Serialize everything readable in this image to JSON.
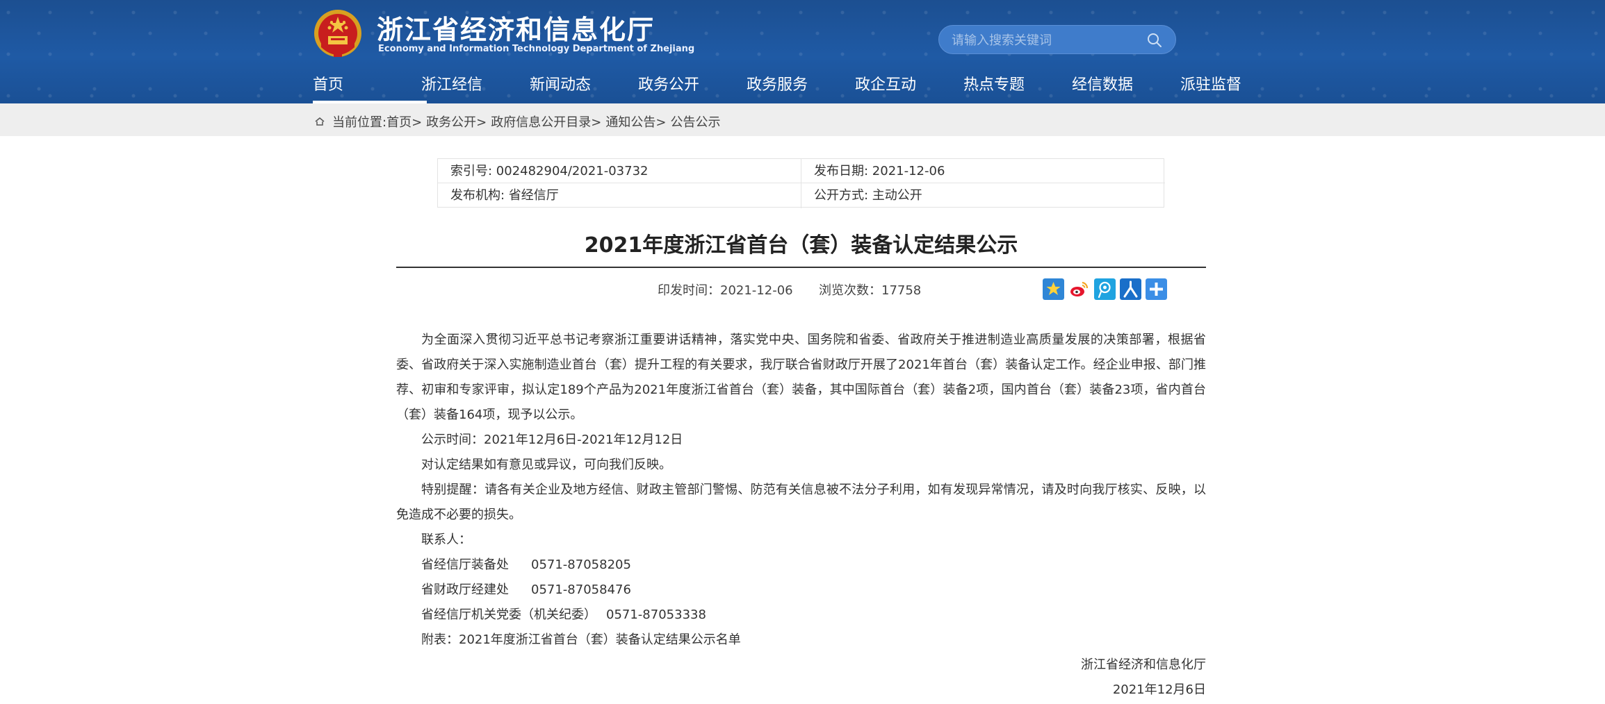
{
  "header": {
    "title_cn": "浙江省经济和信息化厅",
    "title_en": "Economy and Information Technology Department of Zhejiang",
    "search_placeholder": "请输入搜索关键词",
    "colors": {
      "header_bg": "#1f5aa5",
      "search_bg": "#3f7ccb"
    }
  },
  "nav": {
    "items": [
      {
        "label": "首页",
        "active": true
      },
      {
        "label": "浙江经信"
      },
      {
        "label": "新闻动态"
      },
      {
        "label": "政务公开"
      },
      {
        "label": "政务服务"
      },
      {
        "label": "政企互动"
      },
      {
        "label": "热点专题"
      },
      {
        "label": "经信数据"
      },
      {
        "label": "派驻监督"
      }
    ]
  },
  "breadcrumb": {
    "prefix": "当前位置:",
    "items": [
      "首页>",
      "政务公开>",
      "政府信息公开目录>",
      "通知公告>",
      "公告公示"
    ]
  },
  "meta": {
    "index_no": "索引号: 002482904/2021-03732",
    "publish_date": "发布日期: 2021-12-06",
    "publisher": "发布机构: 省经信厅",
    "open_mode": "公开方式: 主动公开"
  },
  "article": {
    "title": "2021年度浙江省首台（套）装备认定结果公示",
    "print_time": "印发时间：2021-12-06",
    "views": "浏览次数：17758",
    "share_icons": [
      "favorite-icon",
      "weibo-icon",
      "tencent-weibo-icon",
      "renren-icon",
      "more-share-icon"
    ],
    "paragraphs": [
      "为全面深入贯彻习近平总书记考察浙江重要讲话精神，落实党中央、国务院和省委、省政府关于推进制造业高质量发展的决策部署，根据省委、省政府关于深入实施制造业首台（套）提升工程的有关要求，我厅联合省财政厅开展了2021年首台（套）装备认定工作。经企业申报、部门推荐、初审和专家评审，拟认定189个产品为2021年度浙江省首台（套）装备，其中国际首台（套）装备2项，国内首台（套）装备23项，省内首台（套）装备164项，现予以公示。"
    ],
    "notice_time": "公示时间：2021年12月6日-2021年12月12日",
    "feedback": "对认定结果如有意见或异议，可向我们反映。",
    "reminder": "特别提醒：请各有关企业及地方经信、财政主管部门警惕、防范有关信息被不法分子利用，如有发现异常情况，请及时向我厅核实、反映，以免造成不必要的损失。",
    "contacts_label": "联系人：",
    "contacts": [
      {
        "dept": "省经信厅装备处",
        "phone": "0571-87058205"
      },
      {
        "dept": "省财政厅经建处",
        "phone": "0571-87058476"
      },
      {
        "dept": "省经信厅机关党委（机关纪委）",
        "phone": "0571-87053338"
      }
    ],
    "attachment": "附表：2021年度浙江省首台（套）装备认定结果公示名单",
    "signature_org": "浙江省经济和信息化厅",
    "signature_date": "2021年12月6日"
  }
}
